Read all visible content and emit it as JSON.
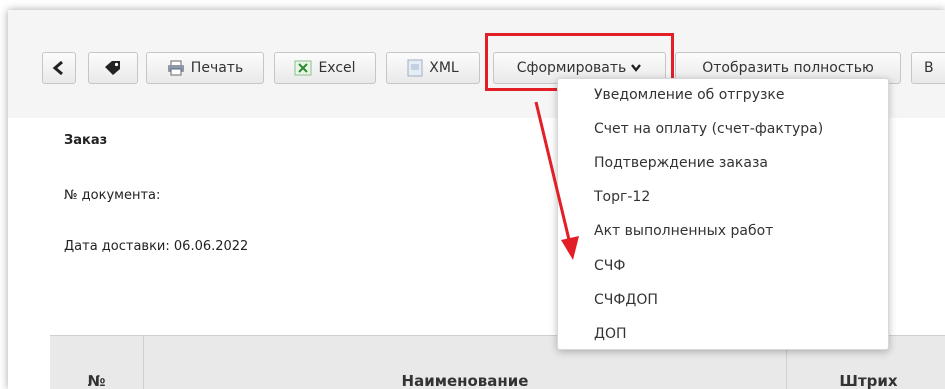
{
  "toolbar": {
    "back_icon": "chevron-left-icon",
    "tag_icon": "tag-icon",
    "print_label": "Печать",
    "excel_label": "Excel",
    "xml_label": "XML",
    "form_label": "Сформировать",
    "show_full_label": "Отобразить полностью",
    "cut_label": "В"
  },
  "document": {
    "title": "Заказ",
    "doc_number_label": "№ документа:",
    "delivery_date_label": "Дата доставки: 06.06.2022"
  },
  "table": {
    "col_num": "№",
    "col_name": "Наименование",
    "col_barcode": "Штрих"
  },
  "dropdown": {
    "items": [
      "Уведомление об отгрузке",
      "Счет на оплату (счет-фактура)",
      "Подтверждение заказа",
      "Торг-12",
      "Акт выполненных работ",
      "СЧФ",
      "СЧФДОП",
      "ДОП"
    ]
  },
  "colors": {
    "highlight": "#e21f26",
    "arrow": "#e21f26"
  }
}
